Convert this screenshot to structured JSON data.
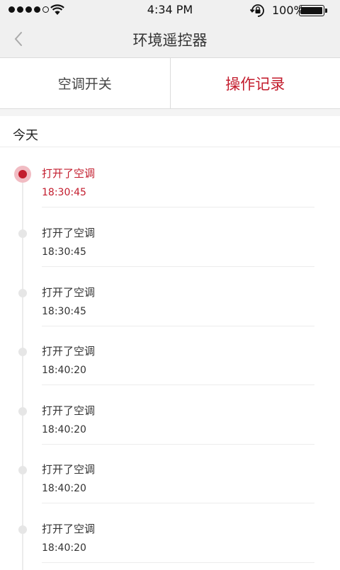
{
  "status_bar": {
    "time": "4:34 PM",
    "battery": "100%",
    "signal_bars_filled": 4,
    "signal_bars_total": 5,
    "icons": [
      "signal-dots-icon",
      "wifi-icon",
      "rotation-lock-icon",
      "battery-icon"
    ]
  },
  "nav": {
    "title": "环境遥控器",
    "back_icon": "chevron-left-icon"
  },
  "tabs": [
    {
      "label": "空调开关",
      "active": false
    },
    {
      "label": "操作记录",
      "active": true
    }
  ],
  "section": {
    "title": "今天"
  },
  "records": [
    {
      "action": "打开了空调",
      "time": "18:30:45",
      "active": true
    },
    {
      "action": "打开了空调",
      "time": "18:30:45",
      "active": false
    },
    {
      "action": "打开了空调",
      "time": "18:30:45",
      "active": false
    },
    {
      "action": "打开了空调",
      "time": "18:40:20",
      "active": false
    },
    {
      "action": "打开了空调",
      "time": "18:40:20",
      "active": false
    },
    {
      "action": "打开了空调",
      "time": "18:40:20",
      "active": false
    },
    {
      "action": "打开了空调",
      "time": "18:40:20",
      "active": false
    }
  ],
  "colors": {
    "accent": "#c31c2d",
    "accent_light": "#f1bcc3",
    "bar_background": "#f0f0f0"
  }
}
